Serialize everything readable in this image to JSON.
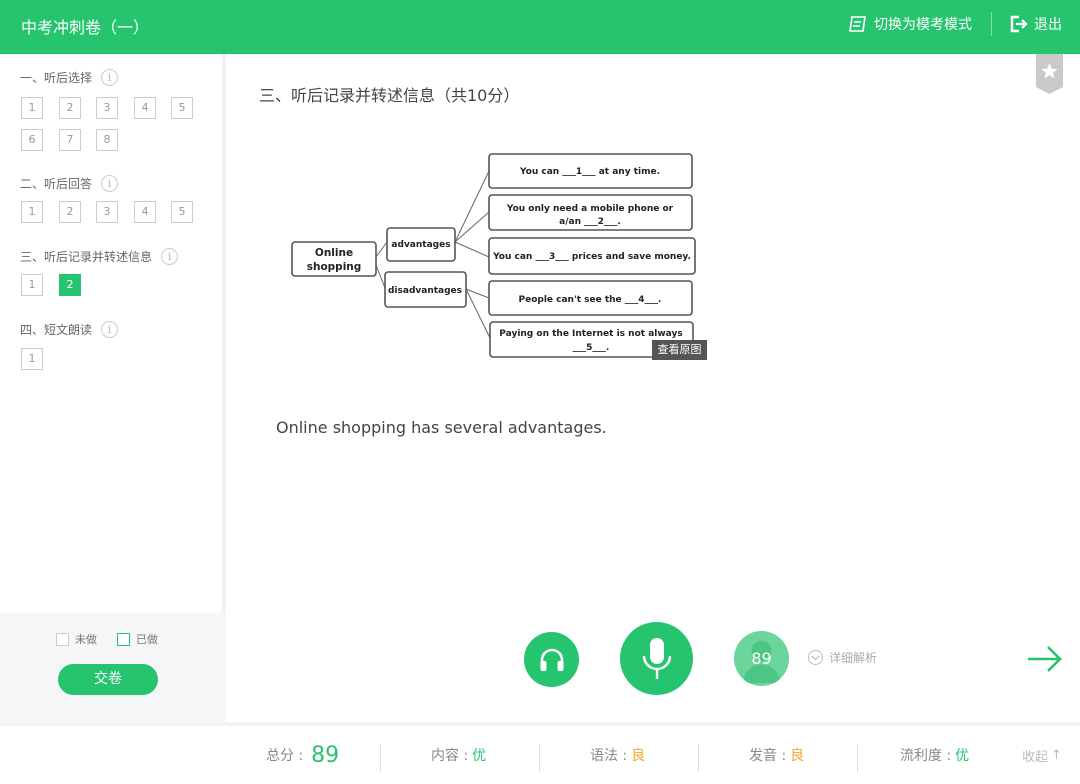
{
  "header": {
    "title": "中考冲刺卷（一）",
    "switch_label": "切换为模考模式",
    "exit_label": "退出"
  },
  "sidebar": {
    "sections": [
      {
        "title": "一、听后选择",
        "items": [
          "1",
          "2",
          "3",
          "4",
          "5",
          "6",
          "7",
          "8"
        ]
      },
      {
        "title": "二、听后回答",
        "items": [
          "1",
          "2",
          "3",
          "4",
          "5"
        ]
      },
      {
        "title": "三、听后记录并转述信息",
        "items": [
          "1",
          "2"
        ],
        "done_item": "2"
      },
      {
        "title": "四、短文朗读",
        "items": [
          "1"
        ]
      }
    ],
    "info_glyph": "i",
    "legend_undone": "未做",
    "legend_done": "已做",
    "submit_label": "交卷"
  },
  "main": {
    "question_title": "三、听后记录并转述信息（共10分）",
    "mind_map": {
      "root": [
        "Online",
        "shopping"
      ],
      "branch_advantages": "advantages",
      "branch_disadvantages": "disadvantages",
      "box1": "You can ___1___ at any time.",
      "box2_line1": "You only need a  mobile phone or",
      "box2_line2": "a/an ___2___.",
      "box3": "You can ___3___ prices and save money.",
      "box4": "People can't see the ___4___.",
      "box5_line1": "Paying on the Internet is not always",
      "box5_line2": "___5___."
    },
    "view_original_label": "查看原图",
    "answer_text": "Online shopping has several advantages.",
    "score_value": "89",
    "detail_label": "详细解析"
  },
  "bottom": {
    "total_label": "总分 :",
    "total_value": "89",
    "content_label": "内容 :",
    "content_value": "优",
    "grammar_label": "语法 :",
    "grammar_value": "良",
    "pronunciation_label": "发音 :",
    "pronunciation_value": "良",
    "fluency_label": "流利度 :",
    "fluency_value": "优",
    "collapse_label": "收起",
    "collapse_glyph": "↑"
  },
  "colors": {
    "accent": "#27c46f",
    "grade_good": "#f5a623"
  },
  "icons": [
    "switch-mode-icon",
    "exit-icon",
    "info-icon",
    "bookmark-star-icon",
    "headphones-icon",
    "microphone-icon",
    "avatar-icon",
    "chevron-down-icon",
    "arrow-right-icon"
  ]
}
